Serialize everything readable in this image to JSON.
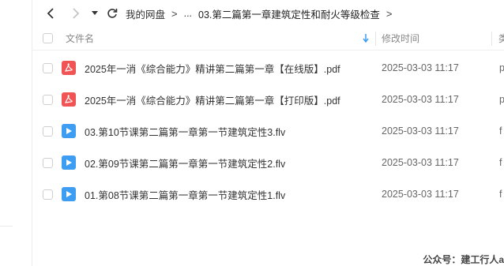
{
  "breadcrumb": {
    "root": "我的网盘",
    "ellipsis": "...",
    "current": "03.第二篇第一章建筑定性和耐火等级检查"
  },
  "header": {
    "name_label": "文件名",
    "time_label": "修改时间",
    "type_label": "类"
  },
  "files": [
    {
      "name": "2025年一消《综合能力》精讲第二篇第一章【在线版】.pdf",
      "time": "2025-03-03 11:17",
      "type": "p",
      "icon": "pdf-icon"
    },
    {
      "name": "2025年一消《综合能力》精讲第二篇第一章【打印版】.pdf",
      "time": "2025-03-03 11:17",
      "type": "p",
      "icon": "pdf-icon"
    },
    {
      "name": "03.第10节课第二篇第一章第一节建筑定性3.flv",
      "time": "2025-03-03 11:17",
      "type": "f",
      "icon": "video-icon"
    },
    {
      "name": "02.第09节课第二篇第一章第一节建筑定性2.flv",
      "time": "2025-03-03 11:17",
      "type": "f",
      "icon": "video-icon"
    },
    {
      "name": "01.第08节课第二篇第一章第一节建筑定性1.flv",
      "time": "2025-03-03 11:17",
      "type": "f",
      "icon": "video-icon"
    }
  ],
  "watermark": "公众号：建工行人a",
  "colors": {
    "pdf": "#f05454",
    "video": "#3d9df2",
    "sort": "#3d9df2"
  }
}
